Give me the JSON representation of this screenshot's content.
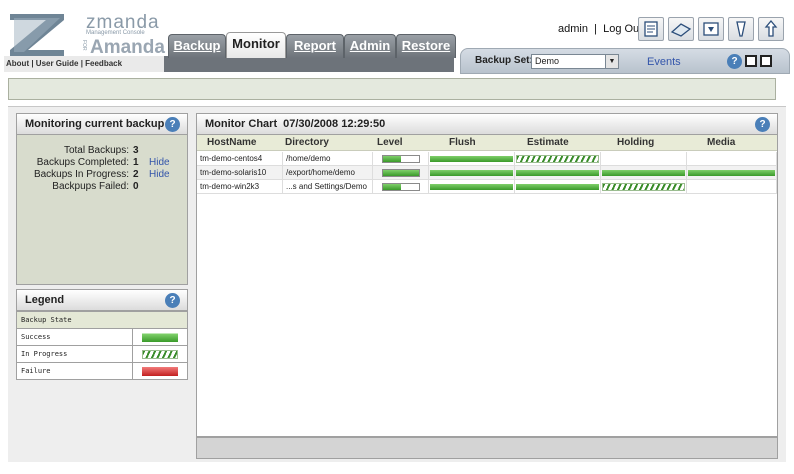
{
  "app": {
    "brand_top": "zmanda",
    "brand_sub": "Management Console",
    "brand_for": "FOR",
    "brand_main": "Amanda",
    "about_links": "About | User Guide | Feedback"
  },
  "tabs": [
    {
      "label": "Backup",
      "active": false
    },
    {
      "label": "Monitor",
      "active": true
    },
    {
      "label": "Report",
      "active": false
    },
    {
      "label": "Admin",
      "active": false
    },
    {
      "label": "Restore",
      "active": false
    }
  ],
  "user": {
    "name": "admin",
    "separator": "|",
    "logout": "Log Out"
  },
  "toolbar_icons": [
    "backup-where-icon",
    "backup-what-icon",
    "backup-how-icon",
    "backup-when-icon",
    "backup-activate-icon"
  ],
  "backup_set": {
    "label": "Backup Set:",
    "value": "Demo",
    "events": "Events"
  },
  "monitor_panel": {
    "title": "Monitoring current backup",
    "rows": [
      {
        "label": "Total Backups:",
        "value": "3",
        "hide": ""
      },
      {
        "label": "Backups Completed:",
        "value": "1",
        "hide": "Hide"
      },
      {
        "label": "Backups In Progress:",
        "value": "2",
        "hide": "Hide"
      },
      {
        "label": "Backpups Failed:",
        "value": "0",
        "hide": ""
      }
    ]
  },
  "legend_panel": {
    "title": "Legend",
    "section": "Backup State",
    "items": [
      {
        "label": "Success",
        "state": "success"
      },
      {
        "label": "In Progress",
        "state": "progress"
      },
      {
        "label": "Failure",
        "state": "failure"
      }
    ]
  },
  "chart_panel": {
    "title": "Monitor Chart",
    "timestamp": "07/30/2008 12:29:50",
    "columns": [
      "HostName",
      "Directory",
      "Level",
      "Flush",
      "Estimate",
      "Holding",
      "Media"
    ],
    "rows": [
      {
        "host": "tm-demo-centos4",
        "dir": "/home/demo",
        "level_fill": 0.5,
        "stages": {
          "flush": "success",
          "estimate": "progress",
          "holding": "",
          "media": ""
        }
      },
      {
        "host": "tm-demo-solaris10",
        "dir": "/export/home/demo",
        "level_fill": 1.0,
        "stages": {
          "flush": "success",
          "estimate": "success",
          "holding": "success",
          "media": "success"
        }
      },
      {
        "host": "tm-demo-win2k3",
        "dir": "...s and Settings/Demo",
        "level_fill": 0.5,
        "stages": {
          "flush": "success",
          "estimate": "success",
          "holding": "progress",
          "media": ""
        }
      }
    ]
  },
  "colors": {
    "success": "#3a9a2a",
    "progress_stripe": "#3a8c2a",
    "failure": "#c22020",
    "accent": "#4a7fb8",
    "link": "#3355aa"
  }
}
